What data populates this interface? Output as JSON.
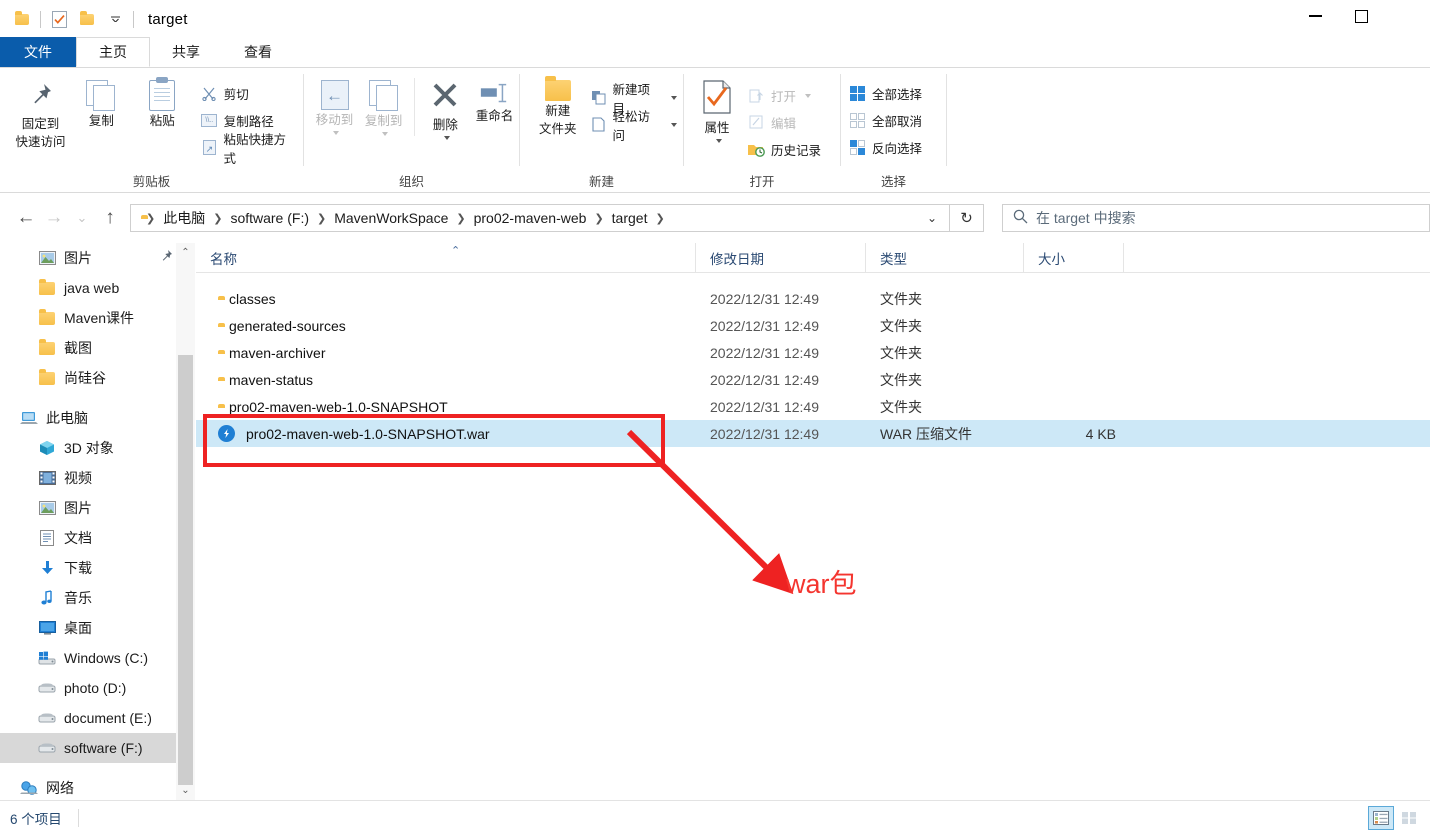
{
  "window": {
    "title": "target",
    "quick_access": [
      "folder-icon",
      "properties-check-icon",
      "new-folder-icon",
      "customize-dropdown"
    ],
    "controls": {
      "minimize": "minimize-icon",
      "maximize": "maximize-icon"
    }
  },
  "tabs": [
    {
      "id": "file",
      "label": "文件"
    },
    {
      "id": "home",
      "label": "主页",
      "active": true
    },
    {
      "id": "share",
      "label": "共享"
    },
    {
      "id": "view",
      "label": "查看"
    }
  ],
  "ribbon": {
    "groups": [
      {
        "name": "clipboard",
        "label": "剪贴板",
        "big": [
          {
            "label_line1": "固定到",
            "label_line2": "快速访问",
            "icon": "pin-icon"
          },
          {
            "label_line1": "复制",
            "label_line2": "",
            "icon": "copy-icon"
          },
          {
            "label_line1": "粘贴",
            "label_line2": "",
            "icon": "paste-icon"
          }
        ],
        "small": [
          {
            "label": "剪切",
            "icon": "scissors-icon"
          },
          {
            "label": "复制路径",
            "icon": "copy-path-icon"
          },
          {
            "label": "粘贴快捷方式",
            "icon": "paste-shortcut-icon"
          }
        ]
      },
      {
        "name": "organize",
        "label": "组织",
        "big": [
          {
            "label_line1": "移动到",
            "label_line2": "",
            "icon": "move-to-icon",
            "dropdown": true,
            "dim": true
          },
          {
            "label_line1": "复制到",
            "label_line2": "",
            "icon": "copy-to-icon",
            "dropdown": true,
            "dim": true
          },
          {
            "label_line1": "删除",
            "label_line2": "",
            "icon": "delete-icon",
            "dropdown": true
          },
          {
            "label_line1": "重命名",
            "label_line2": "",
            "icon": "rename-icon"
          }
        ],
        "small": []
      },
      {
        "name": "new",
        "label": "新建",
        "big": [
          {
            "label_line1": "新建",
            "label_line2": "文件夹",
            "icon": "new-folder-icon"
          }
        ],
        "small": [
          {
            "label": "新建项目",
            "icon": "new-item-icon",
            "dropdown": true
          },
          {
            "label": "轻松访问",
            "icon": "easy-access-icon",
            "dropdown": true
          }
        ]
      },
      {
        "name": "open",
        "label": "打开",
        "big": [
          {
            "label_line1": "属性",
            "label_line2": "",
            "icon": "properties-icon",
            "dropdown": true
          }
        ],
        "small": [
          {
            "label": "打开",
            "icon": "open-icon",
            "dropdown": true,
            "dim": true
          },
          {
            "label": "编辑",
            "icon": "edit-icon",
            "dim": true
          },
          {
            "label": "历史记录",
            "icon": "history-icon"
          }
        ]
      },
      {
        "name": "select",
        "label": "选择",
        "big": [],
        "small": [
          {
            "label": "全部选择",
            "icon": "select-all-icon"
          },
          {
            "label": "全部取消",
            "icon": "select-none-icon"
          },
          {
            "label": "反向选择",
            "icon": "invert-selection-icon"
          }
        ]
      }
    ]
  },
  "address": {
    "back": "back-arrow-icon",
    "forward": "forward-arrow-icon",
    "recent": "recent-dropdown-icon",
    "up": "up-arrow-icon",
    "breadcrumbs": [
      "此电脑",
      "software (F:)",
      "MavenWorkSpace",
      "pro02-maven-web",
      "target"
    ],
    "dropdown": "address-dropdown-icon",
    "refresh": "refresh-icon"
  },
  "search": {
    "placeholder": "在 target 中搜索",
    "icon": "search-icon"
  },
  "sidebar": {
    "items": [
      {
        "label": "图片",
        "icon": "picture-icon",
        "indent": 1,
        "pinned": true
      },
      {
        "label": "java web",
        "icon": "folder-icon",
        "indent": 1
      },
      {
        "label": "Maven课件",
        "icon": "folder-icon",
        "indent": 1
      },
      {
        "label": "截图",
        "icon": "folder-icon",
        "indent": 1
      },
      {
        "label": "尚硅谷",
        "icon": "folder-icon",
        "indent": 1
      },
      {
        "label": "此电脑",
        "icon": "this-pc-icon",
        "indent": 0,
        "gap_before": true
      },
      {
        "label": "3D 对象",
        "icon": "3d-objects-icon",
        "indent": 1
      },
      {
        "label": "视频",
        "icon": "videos-icon",
        "indent": 1
      },
      {
        "label": "图片",
        "icon": "picture-icon",
        "indent": 1
      },
      {
        "label": "文档",
        "icon": "documents-icon",
        "indent": 1
      },
      {
        "label": "下载",
        "icon": "downloads-icon",
        "indent": 1
      },
      {
        "label": "音乐",
        "icon": "music-icon",
        "indent": 1
      },
      {
        "label": "桌面",
        "icon": "desktop-icon",
        "indent": 1
      },
      {
        "label": "Windows (C:)",
        "icon": "windows-drive-icon",
        "indent": 1
      },
      {
        "label": "photo (D:)",
        "icon": "drive-icon",
        "indent": 1
      },
      {
        "label": "document (E:)",
        "icon": "drive-icon",
        "indent": 1
      },
      {
        "label": "software (F:)",
        "icon": "drive-icon",
        "indent": 1,
        "selected": true
      },
      {
        "label": "网络",
        "icon": "network-icon",
        "indent": 0,
        "gap_before": true
      }
    ]
  },
  "filelist": {
    "columns": [
      {
        "key": "name",
        "label": "名称",
        "sorted": "asc"
      },
      {
        "key": "date",
        "label": "修改日期"
      },
      {
        "key": "type",
        "label": "类型"
      },
      {
        "key": "size",
        "label": "大小"
      }
    ],
    "rows": [
      {
        "name": "classes",
        "date": "2022/12/31 12:49",
        "type": "文件夹",
        "size": "",
        "icon": "folder-icon"
      },
      {
        "name": "generated-sources",
        "date": "2022/12/31 12:49",
        "type": "文件夹",
        "size": "",
        "icon": "folder-icon"
      },
      {
        "name": "maven-archiver",
        "date": "2022/12/31 12:49",
        "type": "文件夹",
        "size": "",
        "icon": "folder-icon"
      },
      {
        "name": "maven-status",
        "date": "2022/12/31 12:49",
        "type": "文件夹",
        "size": "",
        "icon": "folder-icon"
      },
      {
        "name": "pro02-maven-web-1.0-SNAPSHOT",
        "date": "2022/12/31 12:49",
        "type": "文件夹",
        "size": "",
        "icon": "folder-icon"
      },
      {
        "name": "pro02-maven-web-1.0-SNAPSHOT.war",
        "date": "2022/12/31 12:49",
        "type": "WAR 压缩文件",
        "size": "4 KB",
        "icon": "war-file-icon",
        "selected": true
      }
    ]
  },
  "statusbar": {
    "item_count": "6 个项目",
    "view_details_icon": "details-view-icon",
    "view_large_icon": "large-icons-view-icon"
  },
  "annotation": {
    "label": "war包",
    "color": "#f4352f",
    "box_color": "#ee2222"
  }
}
